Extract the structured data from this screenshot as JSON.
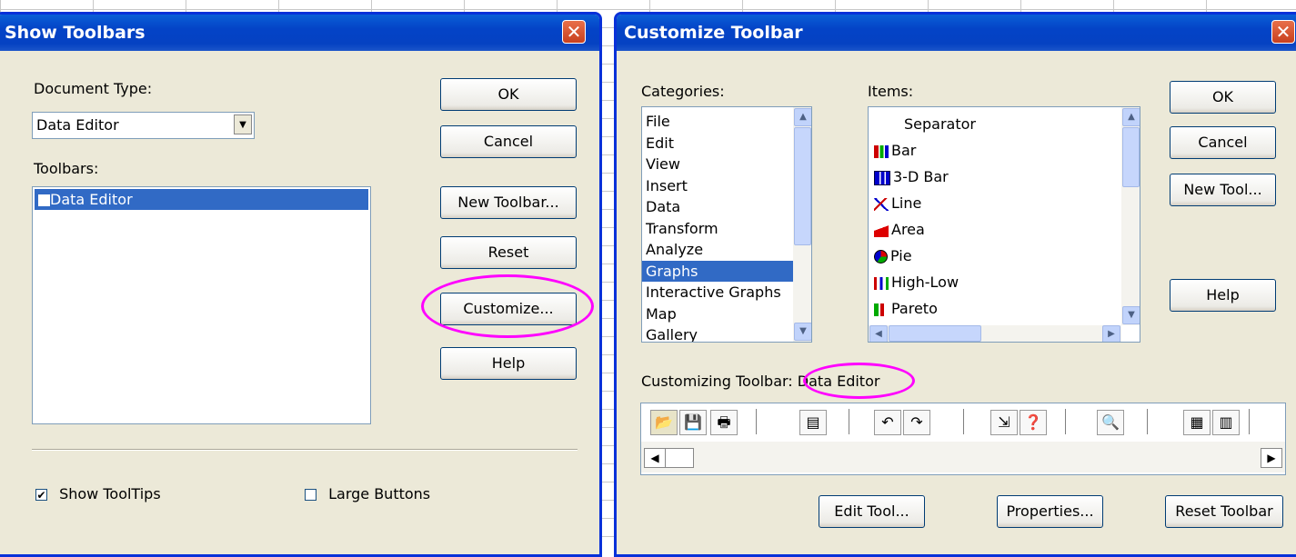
{
  "show_toolbars": {
    "title": "Show Toolbars",
    "doc_type_label": "Document Type:",
    "doc_type_value": "Data Editor",
    "toolbars_label": "Toolbars:",
    "toolbars": [
      {
        "label": "Data Editor",
        "checked": true
      }
    ],
    "buttons": {
      "ok": "OK",
      "cancel": "Cancel",
      "new_toolbar": "New Toolbar...",
      "reset": "Reset",
      "customize": "Customize...",
      "help": "Help"
    },
    "show_tooltips": "Show ToolTips",
    "large_buttons": "Large Buttons"
  },
  "customize_toolbar": {
    "title": "Customize Toolbar",
    "categories_label": "Categories:",
    "categories": [
      "File",
      "Edit",
      "View",
      "Insert",
      "Data",
      "Transform",
      "Analyze",
      "Graphs",
      "Interactive Graphs",
      "Map",
      "Gallery"
    ],
    "selected_category": "Graphs",
    "items_label": "Items:",
    "items": [
      "Separator",
      "Bar",
      "3-D Bar",
      "Line",
      "Area",
      "Pie",
      "High-Low",
      "Pareto"
    ],
    "item_icons": [
      "",
      "bar-chart-icon",
      "3d-bar-chart-icon",
      "line-chart-icon",
      "area-chart-icon",
      "pie-chart-icon",
      "high-low-chart-icon",
      "pareto-chart-icon"
    ],
    "buttons": {
      "ok": "OK",
      "cancel": "Cancel",
      "new_tool": "New Tool...",
      "help": "Help",
      "edit_tool": "Edit Tool...",
      "properties": "Properties...",
      "reset_toolbar": "Reset Toolbar"
    },
    "customizing_label": "Customizing Toolbar:",
    "customizing_value": "Data Editor",
    "toolbar_icons": [
      "open-folder-icon",
      "save-icon",
      "print-icon",
      "dialog-recall-icon",
      "undo-icon",
      "redo-icon",
      "goto-case-icon",
      "variables-icon",
      "find-icon",
      "insert-cases-icon",
      "insert-variable-icon"
    ]
  },
  "accent": "#ff00ff"
}
